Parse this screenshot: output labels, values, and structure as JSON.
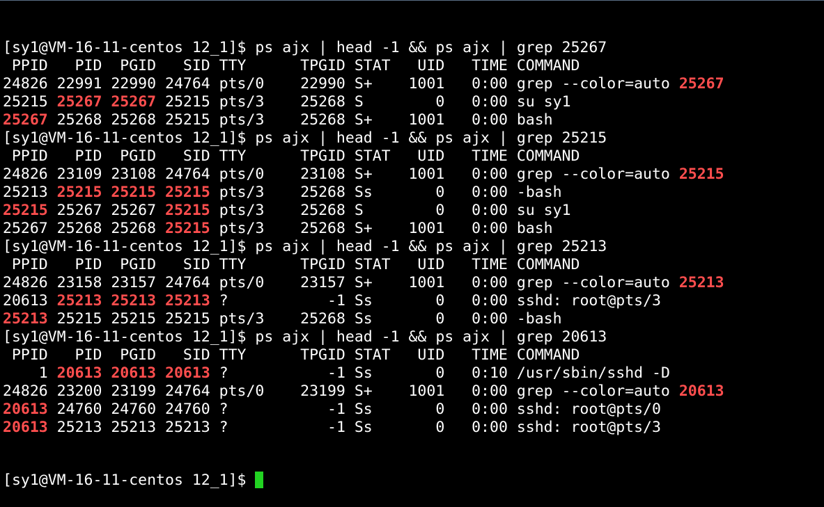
{
  "terminal": {
    "colors": {
      "background": "#000000",
      "text": "#ffffff",
      "match_highlight": "#ff4e4e",
      "cursor": "#22d322"
    },
    "prompt": "[sy1@VM-16-11-centos 12_1]$ ",
    "lines": [
      [
        {
          "t": "[sy1@VM-16-11-centos 12_1]$ ps ajx | head -1 && ps ajx | grep 25267"
        }
      ],
      [
        {
          "t": " PPID   PID  PGID   SID TTY      TPGID STAT   UID   TIME COMMAND"
        }
      ],
      [
        {
          "t": "24826 22991 22990 24764 pts/0    22990 S+    1001   0:00 grep --color=auto "
        },
        {
          "t": "25267",
          "h": true
        }
      ],
      [
        {
          "t": "25215 "
        },
        {
          "t": "25267",
          "h": true
        },
        {
          "t": " "
        },
        {
          "t": "25267",
          "h": true
        },
        {
          "t": " 25215 pts/3    25268 S        0   0:00 su sy1"
        }
      ],
      [
        {
          "t": "25267",
          "h": true
        },
        {
          "t": " 25268 25268 25215 pts/3    25268 S+    1001   0:00 bash"
        }
      ],
      [
        {
          "t": "[sy1@VM-16-11-centos 12_1]$ ps ajx | head -1 && ps ajx | grep 25215"
        }
      ],
      [
        {
          "t": " PPID   PID  PGID   SID TTY      TPGID STAT   UID   TIME COMMAND"
        }
      ],
      [
        {
          "t": "24826 23109 23108 24764 pts/0    23108 S+    1001   0:00 grep --color=auto "
        },
        {
          "t": "25215",
          "h": true
        }
      ],
      [
        {
          "t": "25213 "
        },
        {
          "t": "25215",
          "h": true
        },
        {
          "t": " "
        },
        {
          "t": "25215",
          "h": true
        },
        {
          "t": " "
        },
        {
          "t": "25215",
          "h": true
        },
        {
          "t": " pts/3    25268 Ss       0   0:00 -bash"
        }
      ],
      [
        {
          "t": "25215",
          "h": true
        },
        {
          "t": " 25267 25267 "
        },
        {
          "t": "25215",
          "h": true
        },
        {
          "t": " pts/3    25268 S        0   0:00 su sy1"
        }
      ],
      [
        {
          "t": "25267 25268 25268 "
        },
        {
          "t": "25215",
          "h": true
        },
        {
          "t": " pts/3    25268 S+    1001   0:00 bash"
        }
      ],
      [
        {
          "t": "[sy1@VM-16-11-centos 12_1]$ ps ajx | head -1 && ps ajx | grep 25213"
        }
      ],
      [
        {
          "t": " PPID   PID  PGID   SID TTY      TPGID STAT   UID   TIME COMMAND"
        }
      ],
      [
        {
          "t": "24826 23158 23157 24764 pts/0    23157 S+    1001   0:00 grep --color=auto "
        },
        {
          "t": "25213",
          "h": true
        }
      ],
      [
        {
          "t": "20613 "
        },
        {
          "t": "25213",
          "h": true
        },
        {
          "t": " "
        },
        {
          "t": "25213",
          "h": true
        },
        {
          "t": " "
        },
        {
          "t": "25213",
          "h": true
        },
        {
          "t": " ?           -1 Ss       0   0:00 sshd: root@pts/3"
        }
      ],
      [
        {
          "t": "25213",
          "h": true
        },
        {
          "t": " 25215 25215 25215 pts/3    25268 Ss       0   0:00 -bash"
        }
      ],
      [
        {
          "t": "[sy1@VM-16-11-centos 12_1]$ ps ajx | head -1 && ps ajx | grep 20613"
        }
      ],
      [
        {
          "t": " PPID   PID  PGID   SID TTY      TPGID STAT   UID   TIME COMMAND"
        }
      ],
      [
        {
          "t": "    1 "
        },
        {
          "t": "20613",
          "h": true
        },
        {
          "t": " "
        },
        {
          "t": "20613",
          "h": true
        },
        {
          "t": " "
        },
        {
          "t": "20613",
          "h": true
        },
        {
          "t": " ?           -1 Ss       0   0:10 /usr/sbin/sshd -D"
        }
      ],
      [
        {
          "t": "24826 23200 23199 24764 pts/0    23199 S+    1001   0:00 grep --color=auto "
        },
        {
          "t": "20613",
          "h": true
        }
      ],
      [
        {
          "t": "20613",
          "h": true
        },
        {
          "t": " 24760 24760 24760 ?           -1 Ss       0   0:00 sshd: root@pts/0"
        }
      ],
      [
        {
          "t": "20613",
          "h": true
        },
        {
          "t": " 25213 25213 25213 ?           -1 Ss       0   0:00 sshd: root@pts/3"
        }
      ]
    ]
  }
}
